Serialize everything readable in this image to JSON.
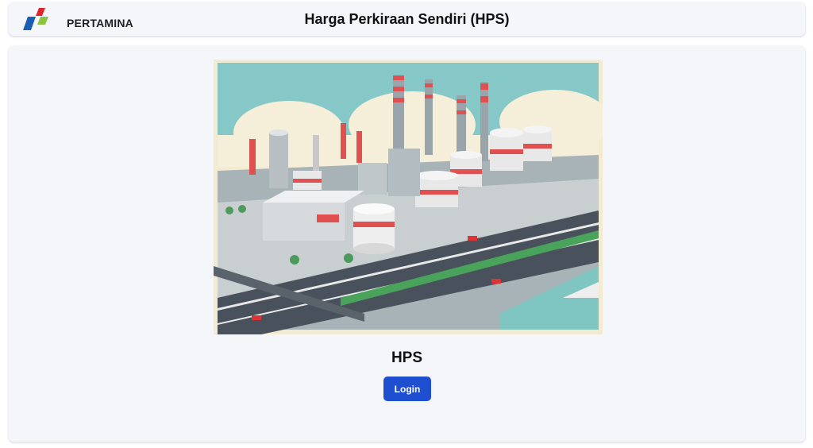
{
  "header": {
    "brand": "PERTAMINA",
    "title": "Harga Perkiraan Sendiri (HPS)"
  },
  "main": {
    "hero_image": "industrial-refinery-illustration",
    "app_title": "HPS",
    "login_label": "Login"
  },
  "colors": {
    "accent": "#1f4fd1",
    "logo_red": "#e0242a",
    "logo_green": "#8bc53f",
    "logo_blue": "#1a5fb4",
    "panel_bg": "#f4f6f9"
  }
}
